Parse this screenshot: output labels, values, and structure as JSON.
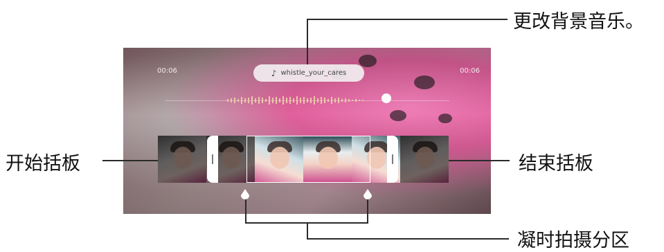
{
  "player": {
    "time_start": "00:06",
    "time_end": "00:06",
    "music_title": "whistle_your_cares",
    "music_icon": "music-note-icon"
  },
  "annotations": {
    "change_bgm": "更改背景音乐。",
    "start_handle": "开始括板",
    "end_handle": "结束括板",
    "slow_motion_section": "凝时拍摄分区"
  },
  "colors": {
    "callout_line": "#2a2a2a",
    "handle": "#ffffff",
    "accent_pink": "#e0609c"
  }
}
